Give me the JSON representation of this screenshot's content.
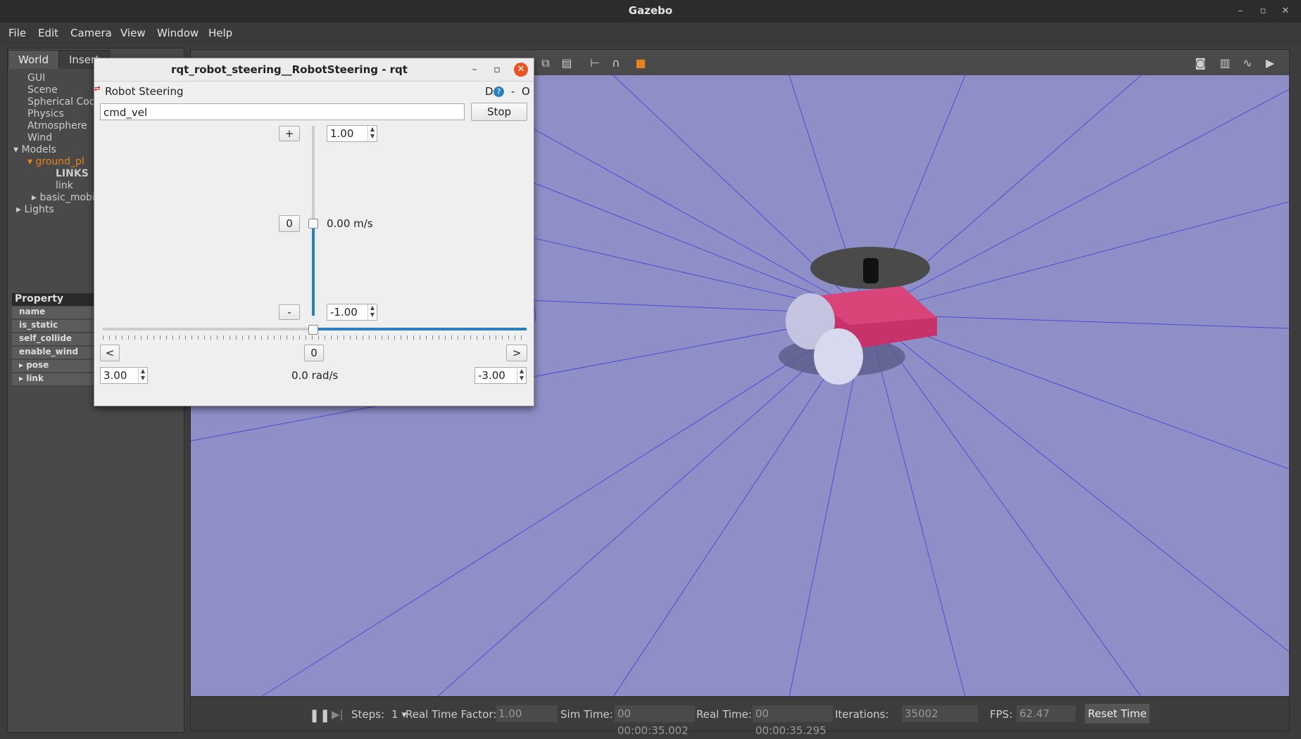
{
  "window": {
    "title": "Gazebo"
  },
  "menu": {
    "items": [
      "File",
      "Edit",
      "Camera",
      "View",
      "Window",
      "Help"
    ]
  },
  "left_panel": {
    "tabs": [
      "World",
      "Insert"
    ],
    "tree": [
      "GUI",
      "Scene",
      "Spherical Coo",
      "Physics",
      "Atmosphere",
      "Wind",
      "Models",
      "ground_pl",
      "LINKS",
      "link",
      "basic_mobi",
      "Lights"
    ],
    "property_header": "Property",
    "properties": [
      "name",
      "is_static",
      "self_collide",
      "enable_wind",
      "pose",
      "link"
    ]
  },
  "rqt": {
    "title": "rqt_robot_steering__RobotSteering - rqt",
    "plugin_name": "Robot Steering",
    "header_buttons": [
      "D",
      "?",
      "-",
      "O"
    ],
    "topic": "cmd_vel",
    "stop_label": "Stop",
    "plus_label": "+",
    "minus_label": "-",
    "zero_label": "0",
    "max_linear": "1.00",
    "min_linear": "-1.00",
    "linear_value": "0.00 m/s",
    "linear_fraction": 0.5,
    "left_label": "<",
    "right_label": ">",
    "zero_angular": "0",
    "max_angular": "3.00",
    "min_angular": "-3.00",
    "angular_value": "0.0 rad/s",
    "angular_fraction": 0.5
  },
  "status": {
    "steps_label": "Steps:",
    "steps_value": "1",
    "rtf_label": "Real Time Factor:",
    "rtf_value": "1.00",
    "sim_time_label": "Sim Time:",
    "sim_time_value": "00 00:00:35.002",
    "real_time_label": "Real Time:",
    "real_time_value": "00 00:00:35.295",
    "iterations_label": "Iterations:",
    "iterations_value": "35002",
    "fps_label": "FPS:",
    "fps_value": "62.47",
    "reset_label": "Reset Time"
  },
  "colors": {
    "accent": "#2c7fbf",
    "close": "#e95420",
    "robot_body": "#c8326a",
    "ground": "#8f8fc8"
  }
}
